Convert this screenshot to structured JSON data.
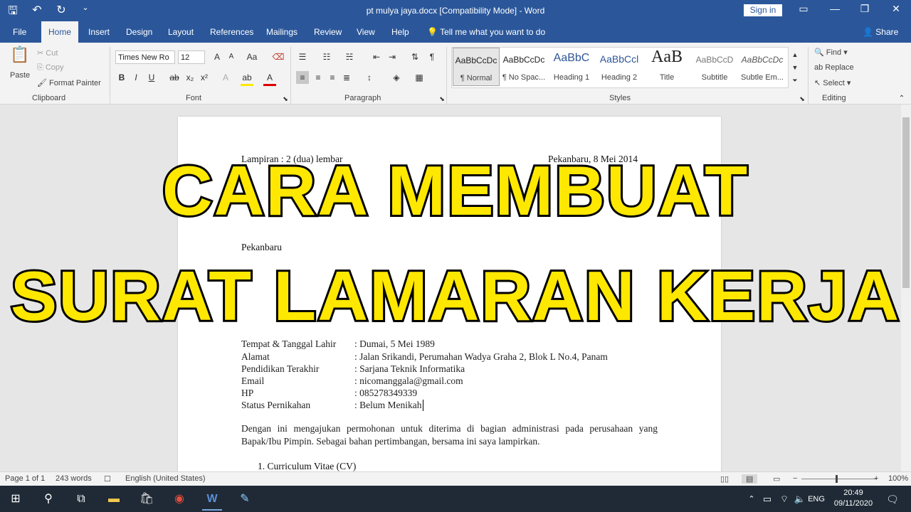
{
  "window": {
    "title": "pt mulya jaya.docx [Compatibility Mode]  -  Word",
    "signin_label": "Sign in",
    "qat_icons": [
      "save-icon",
      "undo-icon",
      "redo-icon",
      "customize-icon"
    ]
  },
  "tabs": [
    "File",
    "Home",
    "Insert",
    "Design",
    "Layout",
    "References",
    "Mailings",
    "Review",
    "View",
    "Help"
  ],
  "tell_me": "Tell me what you want to do",
  "share_label": "Share",
  "clipboard": {
    "paste": "Paste",
    "cut": "Cut",
    "copy": "Copy",
    "format_painter": "Format Painter",
    "group_label": "Clipboard"
  },
  "font": {
    "font_name": "Times New Ro",
    "font_size": "12",
    "group_label": "Font"
  },
  "paragraph": {
    "group_label": "Paragraph"
  },
  "styles": {
    "group_label": "Styles",
    "items": [
      {
        "sample": "AaBbCcDc",
        "name": "¶ Normal"
      },
      {
        "sample": "AaBbCcDc",
        "name": "¶ No Spac..."
      },
      {
        "sample": "AaBbC",
        "name": "Heading 1"
      },
      {
        "sample": "AaBbCcl",
        "name": "Heading 2"
      },
      {
        "sample": "AaB",
        "name": "Title"
      },
      {
        "sample": "AaBbCcD",
        "name": "Subtitle"
      },
      {
        "sample": "AaBbCcDc",
        "name": "Subtle Em..."
      }
    ]
  },
  "editing": {
    "find": "Find",
    "replace": "Replace",
    "select": "Select",
    "group_label": "Editing"
  },
  "document": {
    "partial_left": "Lampiran : 2 (dua) lembar",
    "partial_right": "Pekanbaru, 8 Mei 2014",
    "city": "Pekanbaru",
    "fields": [
      {
        "label": "Tempat & Tanggal Lahir",
        "value": ": Dumai, 5 Mei 1989"
      },
      {
        "label": "Alamat",
        "value": ": Jalan Srikandi, Perumahan Wadya Graha 2, Blok L No.4, Panam"
      },
      {
        "label": "Pendidikan Terakhir",
        "value": ": Sarjana Teknik Informatika"
      },
      {
        "label": "Email",
        "value": ": nicomanggala@gmail.com"
      },
      {
        "label": "HP",
        "value": ": 085278349339"
      },
      {
        "label": "Status Pernikahan",
        "value": ": Belum Menikah"
      }
    ],
    "paragraph": "Dengan ini mengajukan permohonan untuk diterima di bagian administrasi pada perusahaan yang Bapak/Ibu Pimpin. Sebagai bahan pertimbangan, bersama ini saya lampirkan.",
    "list_item": "1.   Curriculum Vitae (CV)"
  },
  "overlay": {
    "line1": "CARA MEMBUAT",
    "line2": "SURAT LAMARAN KERJA"
  },
  "status": {
    "page": "Page 1 of 1",
    "words": "243 words",
    "language": "English (United States)",
    "zoom": "100%"
  },
  "taskbar": {
    "language": "ENG",
    "time": "20:49",
    "date": "09/11/2020"
  }
}
